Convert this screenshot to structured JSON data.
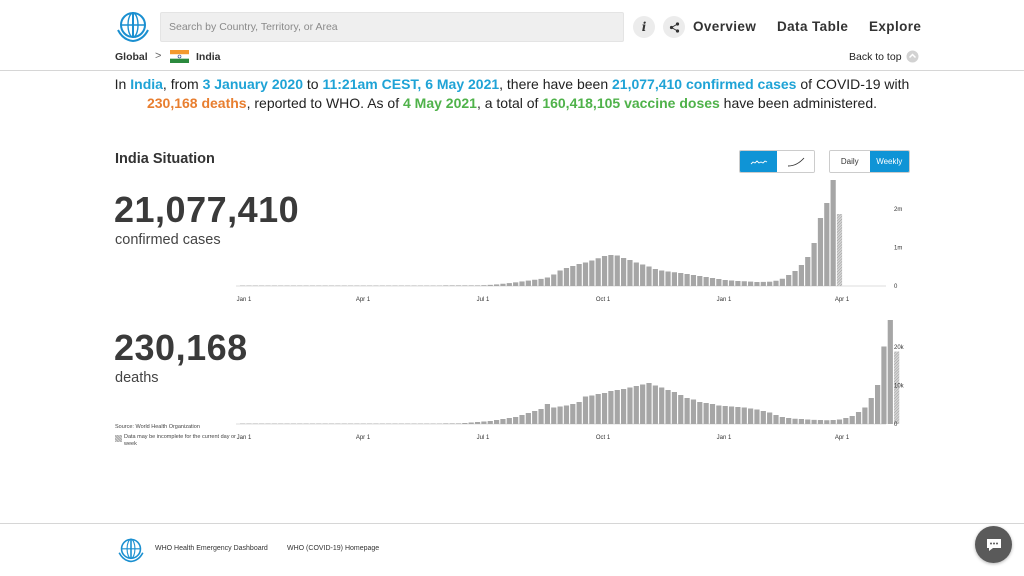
{
  "header": {
    "search_placeholder": "Search by Country, Territory, or Area",
    "info_glyph": "i",
    "nav": {
      "overview": "Overview",
      "data_table": "Data Table",
      "explore": "Explore"
    }
  },
  "breadcrumb": {
    "global": "Global",
    "separator": ">",
    "country": "India",
    "back_to_top": "Back to top"
  },
  "summary": {
    "p1": "In ",
    "country": "India",
    "p2": ", from ",
    "start_date": "3 January 2020",
    "p3": " to ",
    "end_date": "11:21am CEST, 6 May 2021",
    "p4": ", there have been ",
    "cases": "21,077,410 confirmed cases",
    "p5": " of COVID-19 with ",
    "deaths": "230,168 deaths",
    "p6": ", reported to WHO. As of ",
    "vaccine_date": "4 May 2021",
    "p7": ", a total of ",
    "vaccines": "160,418,105 vaccine doses",
    "p8": " have been administered."
  },
  "situation": {
    "title": "India Situation",
    "daily_label": "Daily",
    "weekly_label": "Weekly",
    "cases_total": "21,077,410",
    "cases_label": "confirmed cases",
    "deaths_total": "230,168",
    "deaths_label": "deaths",
    "source": "Source: World Health Organization",
    "legend_note": "Data may be incomplete for the current day or week"
  },
  "colors": {
    "accent": "#0f94d6",
    "blue": "#1fa3d6",
    "orange": "#e87e2f",
    "green": "#4fb24a",
    "bar": "#a6a6a6"
  },
  "icons": [
    "who-logo-icon",
    "info-icon",
    "share-icon",
    "india-flag-icon",
    "back-to-top-icon",
    "weekly-bars-icon",
    "cumulative-line-icon",
    "chat-icon"
  ],
  "footer": {
    "link1": "WHO Health Emergency Dashboard",
    "link2": "WHO (COVID-19) Homepage"
  },
  "chart_data": [
    {
      "type": "bar",
      "ylabel": "",
      "x_ticks": [
        "Jan 1",
        "Apr 1",
        "Jul 1",
        "Oct 1",
        "Jan 1",
        "Apr 1"
      ],
      "y_ticks": [
        "0",
        "1m",
        "2m"
      ],
      "ylim": [
        0,
        2000000
      ],
      "grid": false,
      "values": [
        0,
        0,
        0,
        0,
        0,
        0,
        0,
        0,
        0,
        0,
        0,
        0,
        0,
        0,
        0,
        0,
        0,
        0,
        0,
        0,
        0,
        0,
        0,
        0,
        0,
        0,
        0,
        0,
        0,
        0,
        0,
        0,
        0,
        0,
        0,
        0,
        0,
        0,
        0,
        0,
        0,
        0,
        0,
        0,
        0,
        0,
        0,
        0,
        0,
        0,
        0,
        0,
        0,
        0,
        0,
        0,
        0,
        0,
        0,
        0,
        0,
        0,
        1000,
        2000,
        3000,
        5000,
        7000,
        11000,
        16000,
        23000,
        32000,
        45000,
        58000,
        73000,
        91000,
        108000,
        125000,
        142000,
        170000,
        230000,
        310000,
        360000,
        400000,
        440000,
        470000,
        510000,
        555000,
        600000,
        620000,
        610000,
        560000,
        520000,
        470000,
        430000,
        390000,
        340000,
        310000,
        290000,
        275000,
        260000,
        240000,
        220000,
        200000,
        180000,
        160000,
        140000,
        120000,
        110000,
        100000,
        95000,
        88000,
        80000,
        82000,
        86000,
        105000,
        145000,
        220000,
        300000,
        420000,
        580000,
        860000,
        1360000,
        1660000,
        2530000,
        1440000
      ],
      "incomplete_last": true
    },
    {
      "type": "bar",
      "ylabel": "",
      "x_ticks": [
        "Jan 1",
        "Apr 1",
        "Jul 1",
        "Oct 1",
        "Jan 1",
        "Apr 1"
      ],
      "y_ticks": [
        "0",
        "10k",
        "20k"
      ],
      "ylim": [
        0,
        20000
      ],
      "grid": false,
      "values": [
        0,
        0,
        0,
        0,
        0,
        0,
        0,
        0,
        0,
        0,
        0,
        0,
        0,
        0,
        0,
        0,
        0,
        0,
        0,
        0,
        0,
        0,
        0,
        0,
        0,
        0,
        0,
        0,
        0,
        0,
        0,
        0,
        0,
        0,
        0,
        0,
        0,
        0,
        0,
        0,
        0,
        0,
        0,
        0,
        0,
        0,
        0,
        0,
        0,
        0,
        0,
        0,
        0,
        0,
        0,
        0,
        0,
        0,
        0,
        0,
        0,
        0,
        10,
        40,
        100,
        200,
        300,
        400,
        500,
        600,
        800,
        1000,
        1200,
        1400,
        1800,
        2200,
        2600,
        3000,
        4000,
        3300,
        3500,
        3700,
        4000,
        4400,
        5500,
        5700,
        6000,
        6200,
        6600,
        6800,
        7000,
        7300,
        7600,
        7900,
        8200,
        7700,
        7300,
        6800,
        6400,
        5800,
        5200,
        4900,
        4400,
        4200,
        4000,
        3700,
        3600,
        3500,
        3400,
        3300,
        3100,
        2900,
        2600,
        2300,
        1800,
        1400,
        1200,
        1050,
        1000,
        900,
        830,
        800,
        750,
        800,
        900,
        1200,
        1600,
        2400,
        3300,
        5200,
        7800,
        15500,
        23500,
        14500
      ],
      "incomplete_last": true
    }
  ]
}
